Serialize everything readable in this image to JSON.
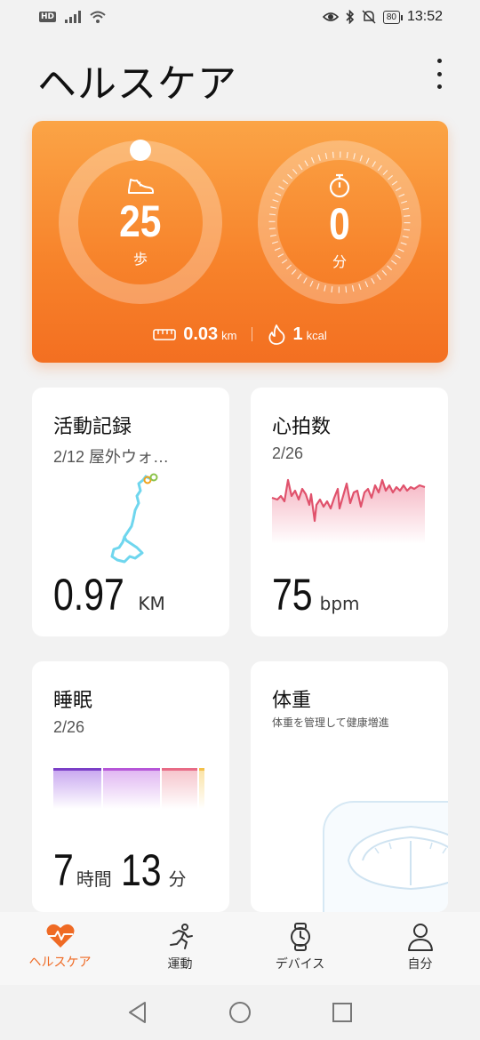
{
  "status_bar": {
    "hd_badge": "HD",
    "battery": "80",
    "time": "13:52"
  },
  "header": {
    "title": "ヘルスケア"
  },
  "summary": {
    "steps_value": "25",
    "steps_unit": "歩",
    "time_value": "0",
    "time_unit": "分",
    "distance_value": "0.03",
    "distance_unit": "km",
    "calories_value": "1",
    "calories_unit": "kcal"
  },
  "cards": {
    "activity": {
      "title": "活動記録",
      "subtitle": "2/12 屋外ウォ…",
      "value": "0.97",
      "unit": "KM"
    },
    "heart": {
      "title": "心拍数",
      "subtitle": "2/26",
      "value": "75",
      "unit": "bpm"
    },
    "sleep": {
      "title": "睡眠",
      "subtitle": "2/26",
      "hours": "7",
      "hours_unit": "時間",
      "minutes": "13",
      "minutes_unit": "分"
    },
    "weight": {
      "title": "体重",
      "subtitle": "体重を管理して健康増進"
    }
  },
  "bottom_nav": [
    {
      "label": "ヘルスケア",
      "icon": "heart-pulse-icon",
      "active": true
    },
    {
      "label": "運動",
      "icon": "running-icon",
      "active": false
    },
    {
      "label": "デバイス",
      "icon": "watch-icon",
      "active": false
    },
    {
      "label": "自分",
      "icon": "person-icon",
      "active": false
    }
  ],
  "colors": {
    "accent": "#ef6a24",
    "hero_top": "#fba446",
    "hero_bottom": "#f36f21",
    "heart_line": "#e0526c",
    "route_line": "#6fd6ee"
  }
}
